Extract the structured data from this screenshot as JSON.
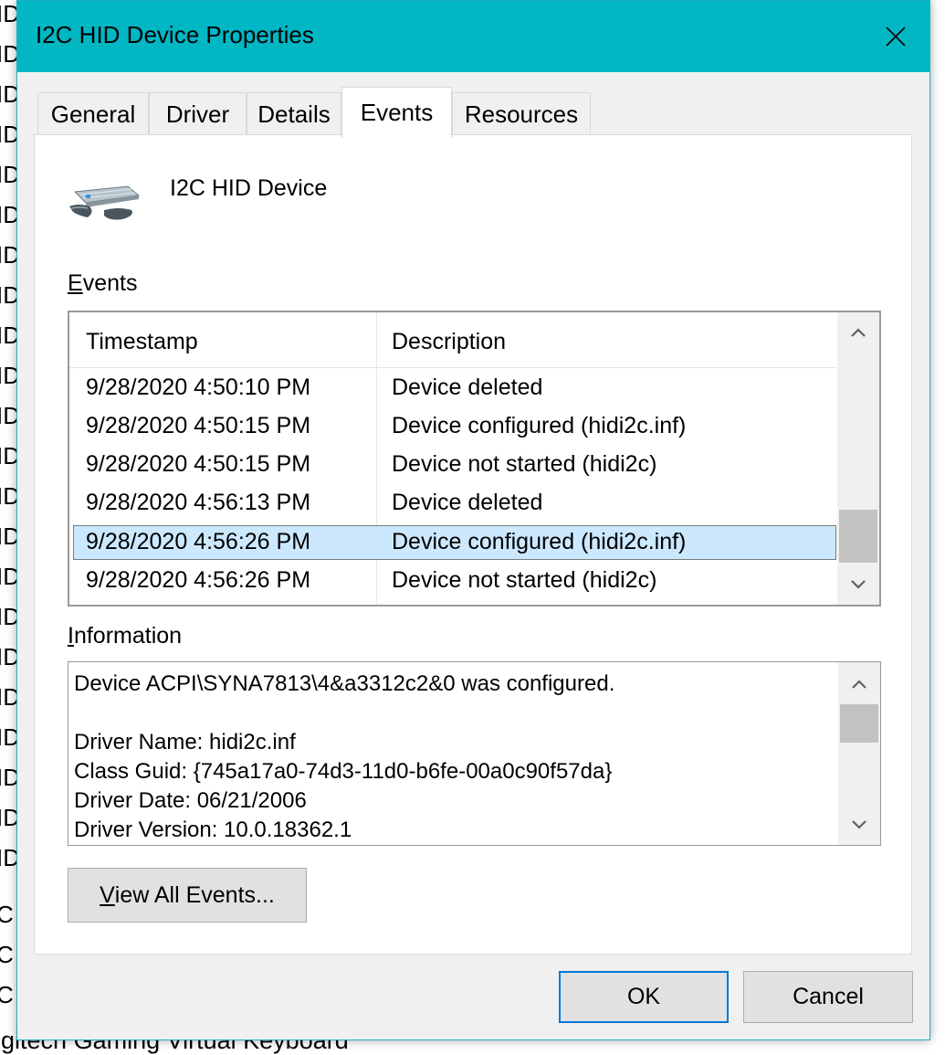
{
  "background": {
    "list_fragments": [
      "ID",
      "ID",
      "ID",
      "ID",
      "ID",
      "ID",
      "ID",
      "ID",
      "ID",
      "ID",
      "ID",
      "ID",
      "ID",
      "ID",
      "ID",
      "ID",
      "ID",
      "ID",
      "ID",
      "ID",
      "ID",
      "ID",
      "C",
      "C",
      "C"
    ],
    "bottom_text": "ogitech Gaming Virtual Keyboard"
  },
  "dialog": {
    "title": "I2C HID Device Properties",
    "accent_color": "#00b7c3"
  },
  "tabs": [
    {
      "label": "General",
      "active": false
    },
    {
      "label": "Driver",
      "active": false
    },
    {
      "label": "Details",
      "active": false
    },
    {
      "label": "Events",
      "active": true
    },
    {
      "label": "Resources",
      "active": false
    }
  ],
  "device": {
    "name": "I2C HID Device",
    "icon": "keyboard-device-icon"
  },
  "events": {
    "label_underline": "E",
    "label_rest": "vents",
    "columns": [
      "Timestamp",
      "Description"
    ],
    "rows": [
      {
        "timestamp": "9/28/2020 4:50:10 PM",
        "description": "Device deleted",
        "selected": false
      },
      {
        "timestamp": "9/28/2020 4:50:15 PM",
        "description": "Device configured (hidi2c.inf)",
        "selected": false
      },
      {
        "timestamp": "9/28/2020 4:50:15 PM",
        "description": "Device not started (hidi2c)",
        "selected": false
      },
      {
        "timestamp": "9/28/2020 4:56:13 PM",
        "description": "Device deleted",
        "selected": false
      },
      {
        "timestamp": "9/28/2020 4:56:26 PM",
        "description": "Device configured (hidi2c.inf)",
        "selected": true
      },
      {
        "timestamp": "9/28/2020 4:56:26 PM",
        "description": "Device not started (hidi2c)",
        "selected": false
      }
    ],
    "selection_color": "#cce8ff"
  },
  "information": {
    "label_underline": "I",
    "label_rest": "nformation",
    "lines": [
      "Device ACPI\\SYNA7813\\4&a3312c2&0 was configured.",
      "",
      "Driver Name: hidi2c.inf",
      "Class Guid: {745a17a0-74d3-11d0-b6fe-00a0c90f57da}",
      "Driver Date: 06/21/2006",
      "Driver Version: 10.0.18362.1"
    ]
  },
  "buttons": {
    "view_all_underline": "V",
    "view_all_rest": "iew All Events...",
    "ok": "OK",
    "cancel": "Cancel"
  }
}
